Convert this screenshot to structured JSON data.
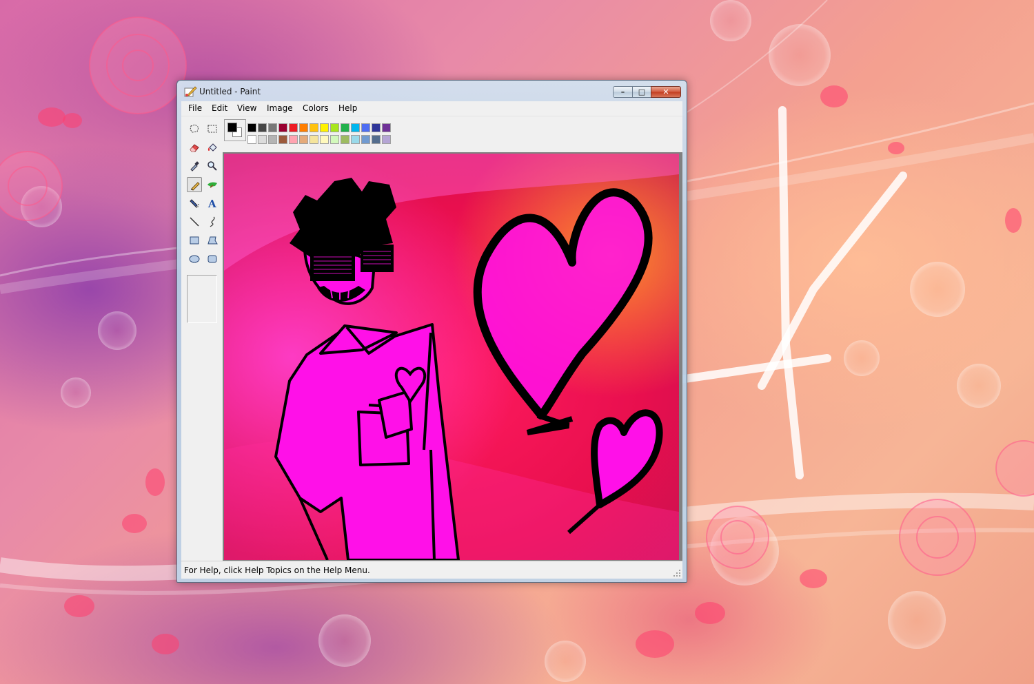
{
  "window": {
    "title": "Untitled - Paint",
    "minimize_label": "–",
    "maximize_label": "□",
    "close_label": "✕"
  },
  "menu": [
    {
      "label": "File"
    },
    {
      "label": "Edit"
    },
    {
      "label": "View"
    },
    {
      "label": "Image"
    },
    {
      "label": "Colors"
    },
    {
      "label": "Help"
    }
  ],
  "tools": [
    {
      "name": "free-form-select",
      "icon": "lasso-icon"
    },
    {
      "name": "select",
      "icon": "rect-select-icon"
    },
    {
      "name": "eraser",
      "icon": "eraser-icon"
    },
    {
      "name": "fill-with-color",
      "icon": "paint-bucket-icon"
    },
    {
      "name": "pick-color",
      "icon": "eyedropper-icon"
    },
    {
      "name": "magnifier",
      "icon": "magnifier-icon"
    },
    {
      "name": "pencil",
      "icon": "pencil-icon",
      "active": true
    },
    {
      "name": "brush",
      "icon": "brush-icon"
    },
    {
      "name": "airbrush",
      "icon": "airbrush-icon"
    },
    {
      "name": "text",
      "icon": "text-icon"
    },
    {
      "name": "line",
      "icon": "line-icon"
    },
    {
      "name": "curve",
      "icon": "curve-icon"
    },
    {
      "name": "rectangle",
      "icon": "rectangle-icon"
    },
    {
      "name": "polygon",
      "icon": "polygon-icon"
    },
    {
      "name": "ellipse",
      "icon": "ellipse-icon"
    },
    {
      "name": "rounded-rectangle",
      "icon": "rounded-rect-icon"
    }
  ],
  "text_tool_glyph": "A",
  "palette": {
    "foreground": "#000000",
    "background": "#ffffff",
    "row1": [
      "#000000",
      "#464646",
      "#787878",
      "#990030",
      "#ed1c24",
      "#ff7e00",
      "#ffc20e",
      "#fff200",
      "#a8e61d",
      "#22b14c",
      "#00b7ef",
      "#4d6df3",
      "#2f3699",
      "#6f3198"
    ],
    "row2": [
      "#ffffff",
      "#dcdcdc",
      "#b4b4b4",
      "#9c5a3c",
      "#ffa3b1",
      "#e5aa7a",
      "#f5e49c",
      "#fff9bd",
      "#d3f9bc",
      "#9dbb61",
      "#99d9ea",
      "#709ad1",
      "#546d8e",
      "#b5a5d5"
    ]
  },
  "status": {
    "help_text": "For Help, click Help Topics on the Help Menu."
  }
}
